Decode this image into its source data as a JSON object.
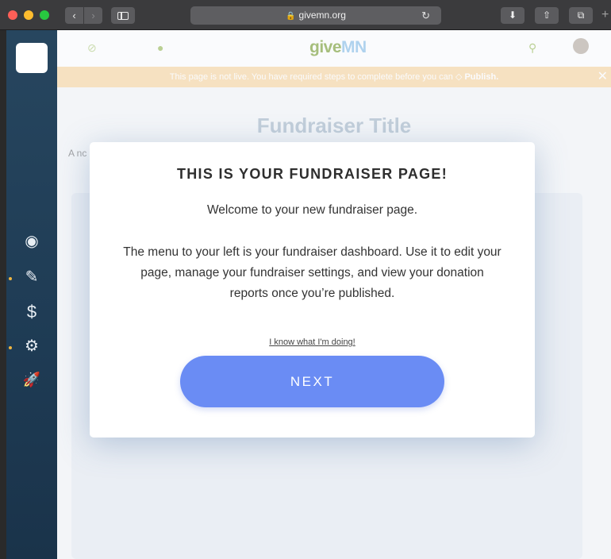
{
  "browser": {
    "url": "givemn.org",
    "back_glyph": "‹",
    "forward_glyph": "›",
    "reload_glyph": "↻",
    "download_glyph": "⬇",
    "share_glyph": "⇧",
    "tabs_glyph": "⧉",
    "plus_glyph": "+"
  },
  "dashboard": {
    "icons": [
      "eye-icon",
      "pencil-icon",
      "dollar-icon",
      "gears-icon",
      "rocket-icon"
    ],
    "eye_glyph": "◉",
    "pencil_glyph": "✎",
    "dollar_glyph": "$",
    "gears_glyph": "⚙",
    "rocket_glyph": "🚀"
  },
  "header": {
    "brand_give": "give",
    "brand_mn": "MN",
    "compass_glyph": "⊘",
    "plus_glyph": "●",
    "search_glyph": "⚲"
  },
  "banner": {
    "text": "This page is not live. You have required steps to complete before you can",
    "publish_label": "Publish.",
    "close_glyph": "✕"
  },
  "page": {
    "title": "Fundraiser Title",
    "description_stub": "A nc"
  },
  "modal": {
    "title": "THIS IS YOUR FUNDRAISER PAGE!",
    "welcome": "Welcome to your new fundraiser page.",
    "body": "The menu to your left is your fundraiser dashboard. Use it to edit your page, manage your fundraiser settings, and view your donation reports once you’re published.",
    "skip_link": "I know what I'm doing!",
    "next_label": "NEXT"
  },
  "colors": {
    "accent": "#6a8cf4",
    "banner": "#f9d8a4",
    "sidebar": "#1e3b54",
    "brand_green": "#7ea23a"
  }
}
